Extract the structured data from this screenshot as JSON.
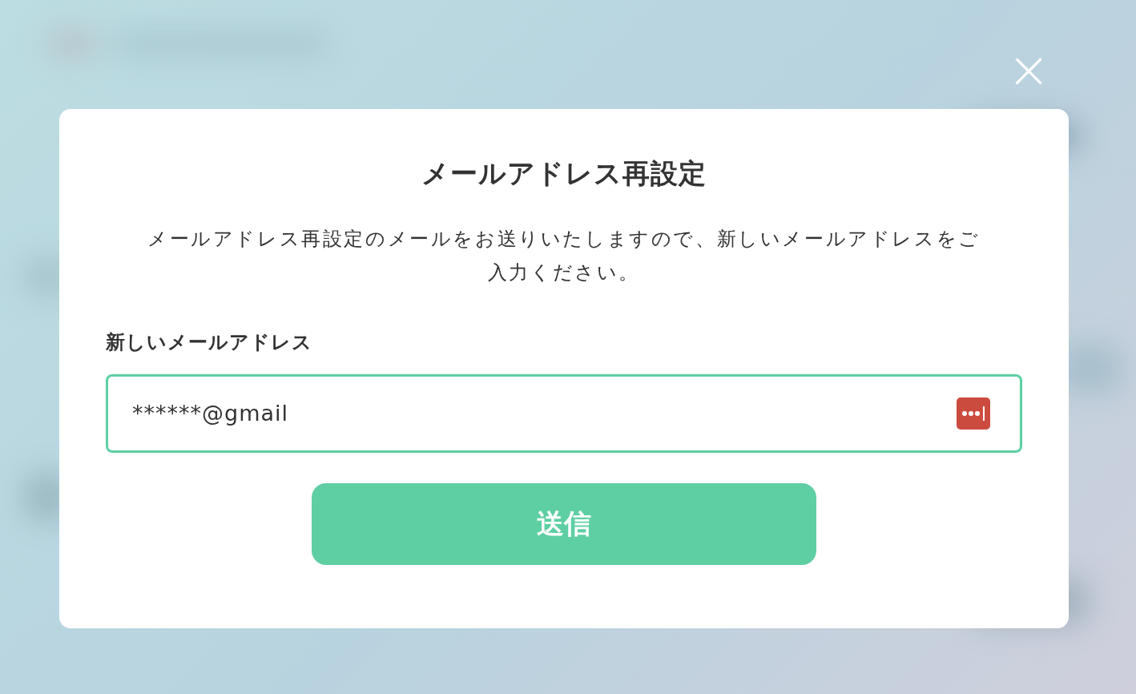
{
  "close_button": {
    "label": "×"
  },
  "dialog": {
    "title": "メールアドレス再設定",
    "description": "メールアドレス再設定のメールをお送りいたしますので、新しいメールアドレスをご入力ください。",
    "field": {
      "label": "新しいメールアドレス",
      "value": "******@gmail"
    },
    "submit_button": {
      "label": "送信"
    }
  }
}
